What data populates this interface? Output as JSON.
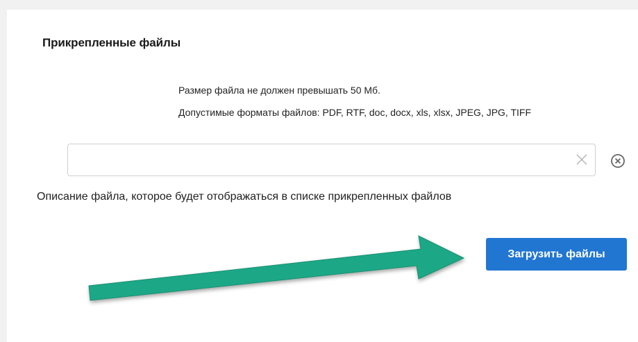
{
  "section": {
    "title": "Прикрепленные файлы"
  },
  "hints": {
    "size_limit": "Размер файла не должен превышать 50 Мб.",
    "formats": "Допустимые форматы файлов: PDF, RTF, doc, docx, xls, xlsx, JPEG, JPG, TIFF"
  },
  "file_description": {
    "value": "",
    "placeholder": "",
    "helper": "Описание файла, которое будет отображаться в списке прикрепленных файлов"
  },
  "actions": {
    "upload_label": "Загрузить файлы"
  },
  "icons": {
    "clear": "close-icon",
    "remove": "circle-close-icon"
  },
  "colors": {
    "primary_button": "#2176d2",
    "annotation_arrow": "#1fa887"
  }
}
